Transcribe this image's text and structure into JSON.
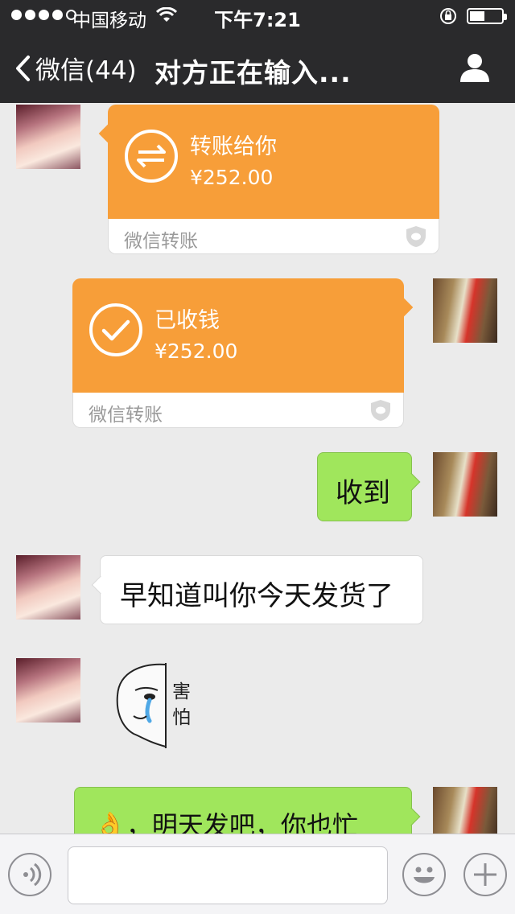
{
  "status_bar": {
    "carrier": "中国移动",
    "time": "下午7:21",
    "signal_bars": 4
  },
  "nav": {
    "back_label": "微信(44)",
    "title": "对方正在输入..."
  },
  "messages": [
    {
      "sender": "contact",
      "type": "transfer",
      "title": "转账给你",
      "amount": "¥252.00",
      "footer": "微信转账"
    },
    {
      "sender": "me",
      "type": "transfer",
      "title": "已收钱",
      "amount": "¥252.00",
      "footer": "微信转账"
    },
    {
      "sender": "me",
      "type": "text",
      "text": "收到"
    },
    {
      "sender": "contact",
      "type": "text",
      "text": "早知道叫你今天发货了"
    },
    {
      "sender": "contact",
      "type": "sticker",
      "caption": "害怕"
    },
    {
      "sender": "me",
      "type": "text",
      "emoji": "👌",
      "text": "，明天发吧，你也忙"
    }
  ],
  "colors": {
    "transfer_orange": "#f79e39",
    "my_bubble": "#a0e65c",
    "nav_bg": "#2a2a2c",
    "chat_bg": "#ebebeb"
  },
  "input_bar": {
    "placeholder": ""
  },
  "icons": [
    "back-chevron-icon",
    "profile-icon",
    "wifi-icon",
    "rotation-lock-icon",
    "battery-icon",
    "transfer-arrows-icon",
    "checkmark-icon",
    "shield-icon",
    "voice-icon",
    "emoji-icon",
    "plus-icon"
  ]
}
